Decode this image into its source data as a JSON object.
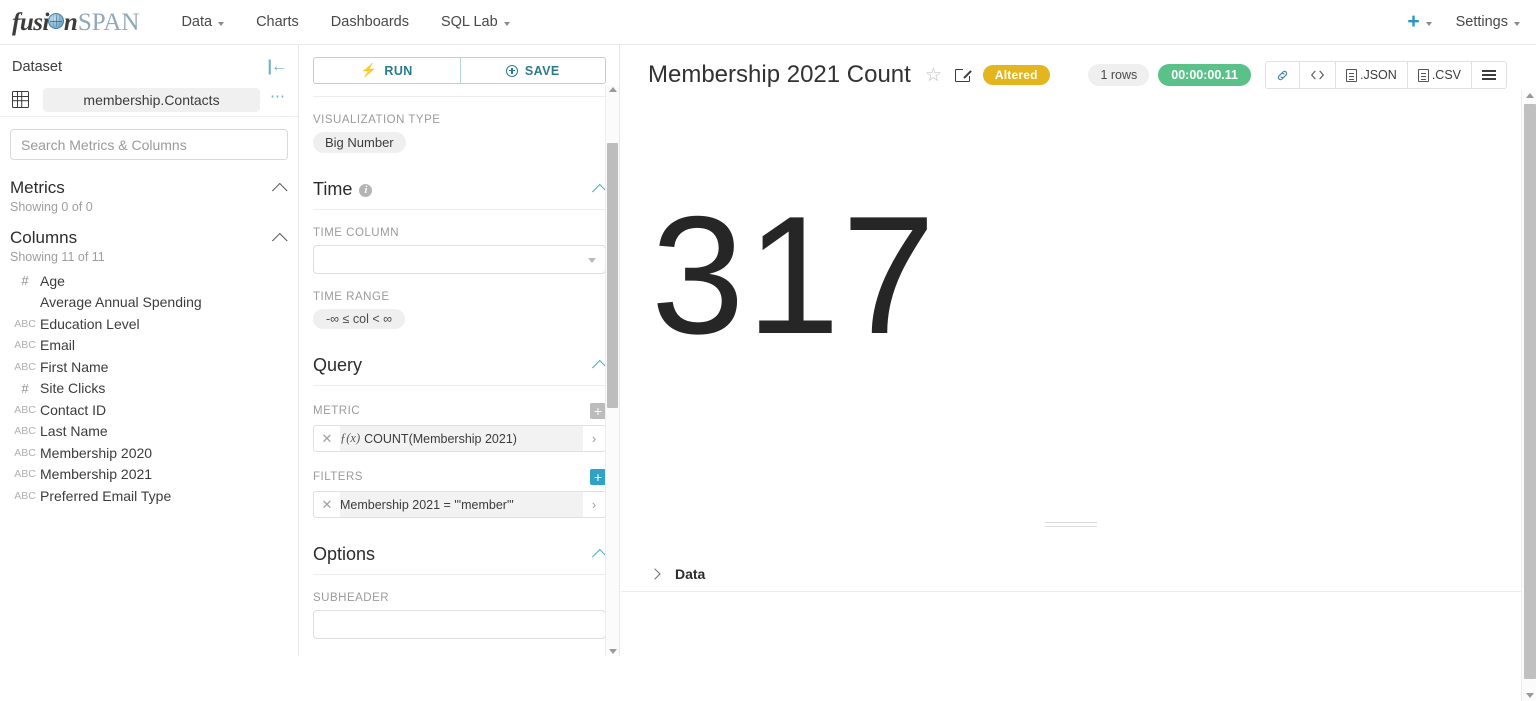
{
  "navbar": {
    "brand": {
      "part1": "fusi",
      "globe": "globe-icon",
      "part2": "n",
      "part3": "SPAN"
    },
    "links": [
      {
        "label": "Data",
        "has_caret": true
      },
      {
        "label": "Charts",
        "has_caret": false
      },
      {
        "label": "Dashboards",
        "has_caret": false
      },
      {
        "label": "SQL Lab",
        "has_caret": true
      }
    ],
    "plus_label": "+",
    "settings_label": "Settings",
    "accent_color": "#2495c6"
  },
  "dataset_panel": {
    "title": "Dataset",
    "collapse_icon": "collapse-left-icon",
    "dataset_name": "membership.Contacts",
    "more_icon": "more-options-icon",
    "search_placeholder": "Search Metrics & Columns",
    "search_value": "",
    "metrics": {
      "title": "Metrics",
      "showing": "Showing 0 of 0"
    },
    "columns": {
      "title": "Columns",
      "showing": "Showing 11 of 11",
      "items": [
        {
          "type": "#",
          "label": "Age"
        },
        {
          "type": "",
          "label": "Average Annual Spending"
        },
        {
          "type": "ABC",
          "label": "Education Level"
        },
        {
          "type": "ABC",
          "label": "Email"
        },
        {
          "type": "ABC",
          "label": "First Name"
        },
        {
          "type": "#",
          "label": "Site Clicks"
        },
        {
          "type": "ABC",
          "label": "Contact ID"
        },
        {
          "type": "ABC",
          "label": "Last Name"
        },
        {
          "type": "ABC",
          "label": "Membership 2020"
        },
        {
          "type": "ABC",
          "label": "Membership 2021"
        },
        {
          "type": "ABC",
          "label": "Preferred Email Type"
        }
      ]
    }
  },
  "control_panel": {
    "run_label": "RUN",
    "save_label": "SAVE",
    "accent_color": "#2a7b8c",
    "visualization_type_label": "VISUALIZATION TYPE",
    "visualization_type_value": "Big Number",
    "time": {
      "section_title": "Time",
      "time_column_label": "TIME COLUMN",
      "time_column_value": "",
      "time_range_label": "TIME RANGE",
      "time_range_value": "-∞ ≤ col < ∞"
    },
    "query": {
      "section_title": "Query",
      "metric_label": "METRIC",
      "metric_value": "COUNT(Membership 2021)",
      "metric_fx": "ƒ(x)",
      "filters_label": "FILTERS",
      "filter_value": "Membership 2021 = '\"member\"'"
    },
    "options": {
      "section_title": "Options",
      "subheader_label": "SUBHEADER"
    }
  },
  "chart_panel": {
    "title": "Membership 2021 Count",
    "star_icon": "star-outline-icon",
    "edit_icon": "edit-pencil-icon",
    "altered_badge": "Altered",
    "altered_color": "#e3b51e",
    "rows_label": "1 rows",
    "timer_label": "00:00:00.11",
    "timer_color": "#5ac189",
    "toolbar": [
      {
        "name": "link-icon",
        "glyph": "link",
        "label": ""
      },
      {
        "name": "code-icon",
        "glyph": "code",
        "label": ""
      },
      {
        "name": "json-export",
        "glyph": "doc",
        "label": ".JSON"
      },
      {
        "name": "csv-export",
        "glyph": "doc",
        "label": ".CSV"
      },
      {
        "name": "menu-icon",
        "glyph": "menu",
        "label": ""
      }
    ],
    "big_number": "317",
    "data_section_label": "Data"
  },
  "chart_data": {
    "type": "bar",
    "title": "Membership 2021 Count",
    "categories": [
      "Membership 2021 = \"member\""
    ],
    "values": [
      317
    ],
    "series": [
      {
        "name": "COUNT(Membership 2021)",
        "values": [
          317
        ]
      }
    ],
    "xlabel": "",
    "ylabel": "COUNT(Membership 2021)",
    "annotations": [
      "1 rows",
      "00:00:00.11"
    ]
  }
}
